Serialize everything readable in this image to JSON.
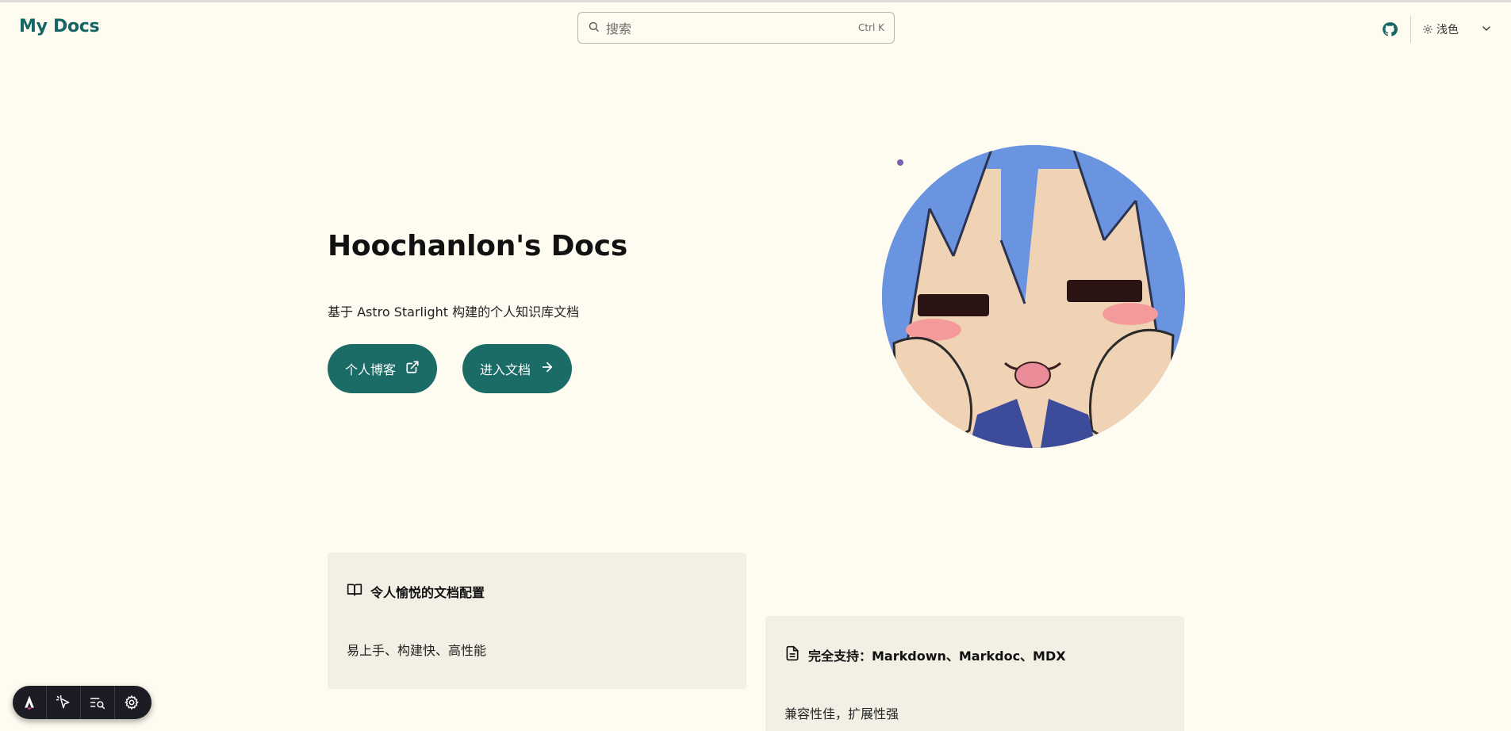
{
  "header": {
    "site_title": "My Docs",
    "search": {
      "placeholder": "搜索",
      "shortcut": "Ctrl K"
    },
    "github_icon": "github-icon",
    "theme": {
      "icon": "sun-icon",
      "label": "浅色",
      "chevron": "chevron-down-icon"
    }
  },
  "hero": {
    "title": "Hoochanlon's Docs",
    "tagline": "基于 Astro Starlight 构建的个人知识库文档",
    "actions": [
      {
        "label": "个人博客",
        "icon": "external-link-icon"
      },
      {
        "label": "进入文档",
        "icon": "arrow-right-icon"
      }
    ],
    "image": "anime-avatar"
  },
  "cards": [
    {
      "icon": "open-book-icon",
      "title": "令人愉悦的文档配置",
      "description": "易上手、构建快、高性能"
    },
    {
      "icon": "document-icon",
      "title": "完全支持：Markdown、Markdoc、MDX",
      "description": "兼容性佳，扩展性强"
    }
  ],
  "dev_toolbar": {
    "items": [
      "astro-logo-icon",
      "cursor-inspect-icon",
      "audit-search-icon",
      "settings-gear-icon"
    ]
  },
  "colors": {
    "background": "#fefcf0",
    "accent": "#1b6b66",
    "title": "#166666",
    "card_bg": "#f2efe4"
  }
}
